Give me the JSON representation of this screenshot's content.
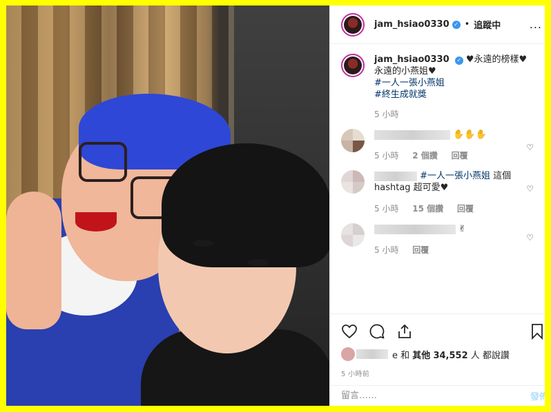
{
  "header": {
    "username": "jam_hsiao0330",
    "verified_icon": "verified-badge-icon",
    "separator": "•",
    "follow_label": "追蹤中",
    "more_label": "..."
  },
  "caption": {
    "username": "jam_hsiao0330",
    "text": "♥永遠的榜樣♥永遠的小燕姐♥",
    "hashtags": [
      "#一人一張小燕姐",
      "#終生成就獎"
    ],
    "time": "5 小時"
  },
  "comments": [
    {
      "text_visible": "✋✋✋",
      "time": "5 小時",
      "likes": "2 個讚",
      "reply": "回覆"
    },
    {
      "hashtag": "#一人一張小燕姐",
      "text": " 這個 hashtag 超可愛♥",
      "time": "5 小時",
      "likes": "15 個讚",
      "reply": "回覆"
    },
    {
      "text_visible": "✌",
      "time": "5 小時",
      "reply": "回覆"
    }
  ],
  "actions": {
    "like_icon": "heart-icon",
    "comment_icon": "comment-icon",
    "share_icon": "share-icon",
    "save_icon": "bookmark-icon"
  },
  "likes": {
    "partial": "e",
    "and": "和",
    "others_label": "其他",
    "count": "34,552",
    "suffix": "人 都說讚"
  },
  "posted": "5 小時前",
  "comment_box": {
    "placeholder": "留言……",
    "post_label": "發佈"
  },
  "colors": {
    "border": "#ffff00",
    "hashtag": "#003569",
    "muted": "#8e8e8e",
    "post_button": "#b2dffc"
  }
}
